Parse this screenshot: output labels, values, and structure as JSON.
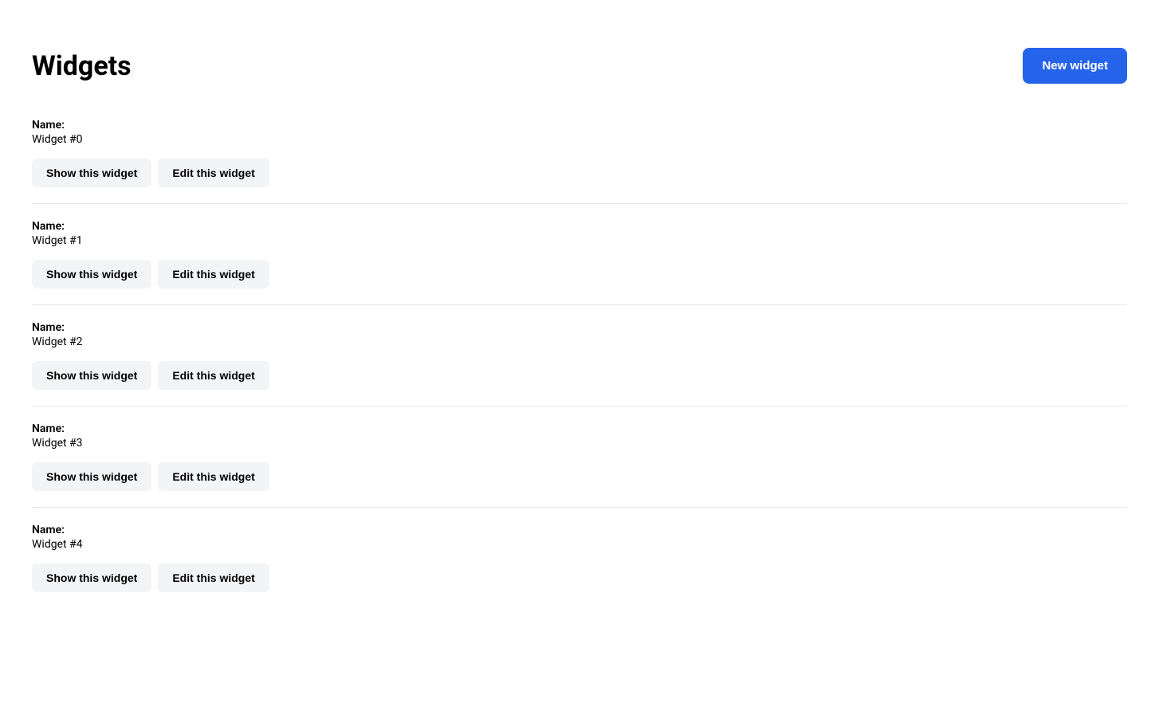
{
  "header": {
    "title": "Widgets",
    "new_widget_button_label": "New widget"
  },
  "widgets": [
    {
      "id": 0,
      "label": "Name:",
      "name": "Widget #0",
      "show_label": "Show this widget",
      "edit_label": "Edit this widget"
    },
    {
      "id": 1,
      "label": "Name:",
      "name": "Widget #1",
      "show_label": "Show this widget",
      "edit_label": "Edit this widget"
    },
    {
      "id": 2,
      "label": "Name:",
      "name": "Widget #2",
      "show_label": "Show this widget",
      "edit_label": "Edit this widget"
    },
    {
      "id": 3,
      "label": "Name:",
      "name": "Widget #3",
      "show_label": "Show this widget",
      "edit_label": "Edit this widget"
    },
    {
      "id": 4,
      "label": "Name:",
      "name": "Widget #4",
      "show_label": "Show this widget",
      "edit_label": "Edit this widget"
    }
  ]
}
